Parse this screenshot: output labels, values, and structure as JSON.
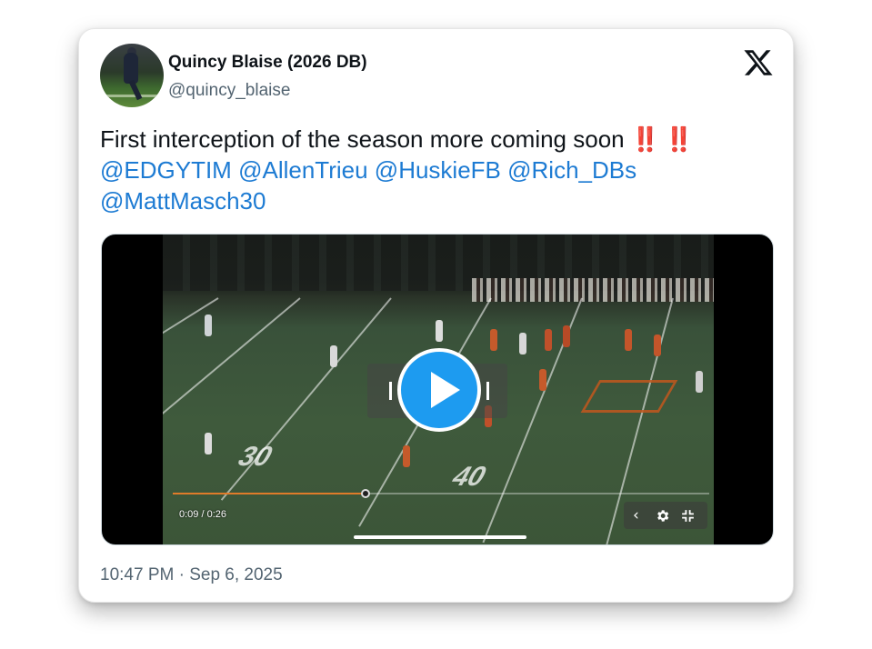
{
  "author": {
    "name": "Quincy Blaise (2026 DB)",
    "handle": "@quincy_blaise"
  },
  "tweet": {
    "text_main": "First interception of the season more coming soon",
    "emoji_1": "‼️",
    "emoji_2": "‼️",
    "mentions": [
      "@EDGYTIM",
      "@AllenTrieu",
      "@HuskieFB",
      "@Rich_DBs",
      "@MattMasch30"
    ]
  },
  "video": {
    "current_time": "0:09",
    "duration": "0:26",
    "time_display": "0:09 / 0:26",
    "progress": 0.36,
    "field_numbers": [
      "30",
      "40"
    ],
    "controls": [
      "chevron-left-icon",
      "gear-icon",
      "exit-fullscreen-icon"
    ]
  },
  "timestamp": "10:47 PM · Sep 6, 2025",
  "colors": {
    "mention": "#1d7bd3",
    "play_button": "#1d9bf0",
    "progress": "#e07b2a"
  }
}
